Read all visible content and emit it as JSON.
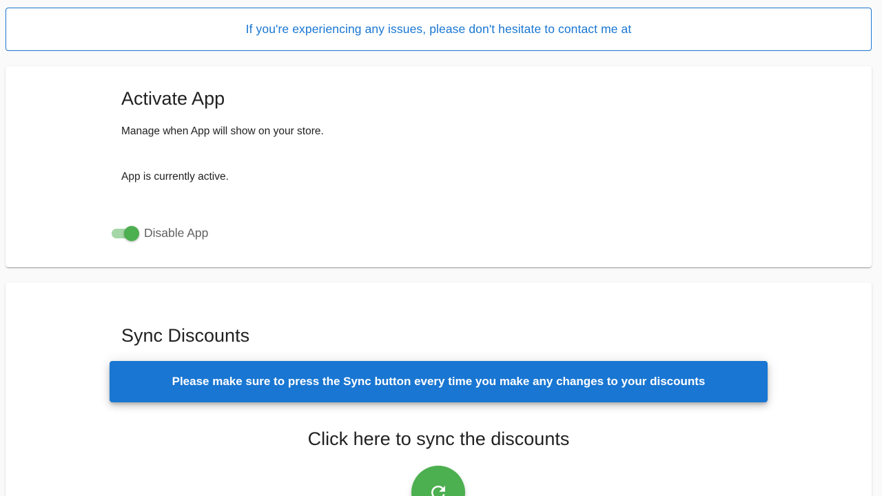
{
  "banner": {
    "text": "If you're experiencing any issues, please don't hesitate to contact me at"
  },
  "activate": {
    "title": "Activate App",
    "description": "Manage when App will show on your store.",
    "status": "App is currently active.",
    "toggle_label": "Disable App",
    "toggle_on": true
  },
  "sync": {
    "title": "Sync Discounts",
    "info": "Please make sure to press the Sync button every time you make any changes to your discounts",
    "cta": "Click here to sync the discounts",
    "button_icon": "sync-icon"
  },
  "colors": {
    "primary": "#1976d2",
    "success": "#4caf50",
    "success_track": "#a5d6a7",
    "white": "#ffffff"
  }
}
